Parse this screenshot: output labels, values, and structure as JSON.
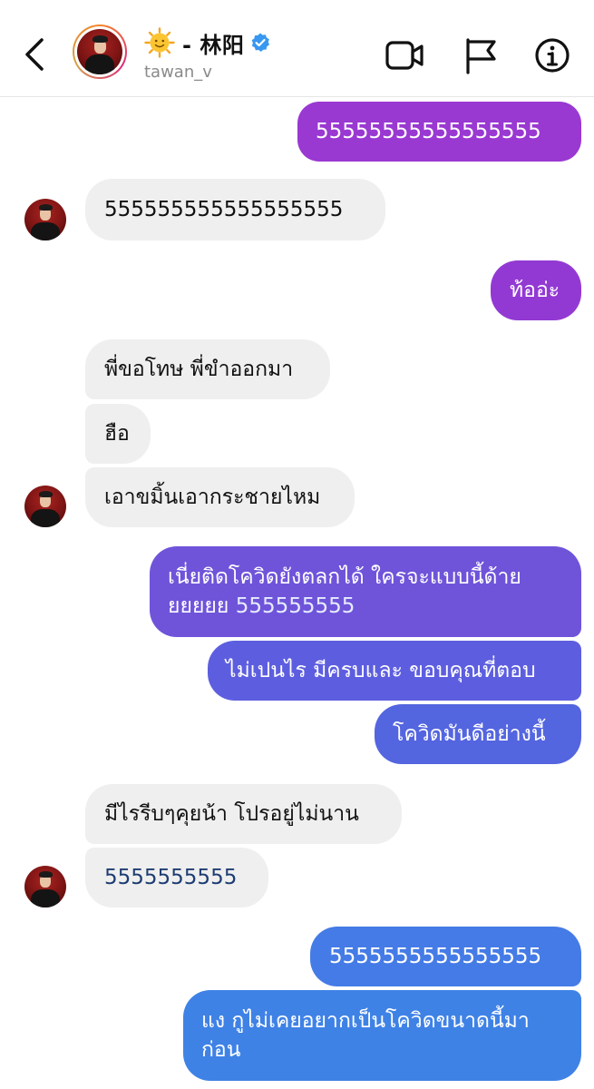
{
  "header": {
    "title": "- 林阳",
    "username": "tawan_v",
    "icons": [
      "back-icon",
      "sun-emoji-icon",
      "verified-badge-icon",
      "video-call-icon",
      "report-flag-icon",
      "info-icon"
    ]
  },
  "colors": {
    "incoming_bubble": "#efefef",
    "outgoing_gradient_top": "#9b38d2",
    "outgoing_gradient_mid": "#6a53d9",
    "outgoing_gradient_bottom": "#3f82e6",
    "verified_blue": "#3897f0"
  },
  "messages": [
    {
      "side": "out",
      "text": "55555555555555555"
    },
    {
      "side": "in",
      "text": "555555555555555555"
    },
    {
      "side": "out",
      "text": "ท้ออ่ะ"
    },
    {
      "side": "in",
      "text": "พี่ขอโทษ พี่ขำออกมา"
    },
    {
      "side": "in",
      "text": "ฮือ"
    },
    {
      "side": "in",
      "text": "เอาขมิ้นเอากระชายไหม"
    },
    {
      "side": "out",
      "line1": "เนี่ยติดโควิดยังตลกได้ ใครจะแบบนี้ด้าย",
      "line2_text": "ยยยยย ",
      "line2_num": "555555555"
    },
    {
      "side": "out",
      "text": "ไม่เปนไร มีครบและ ขอบคุณที่ตอบ"
    },
    {
      "side": "out",
      "text": "โควิดมันดีอย่างนี้"
    },
    {
      "side": "in",
      "text": "มีไรรีบๆคุยน้า โปรอยู่ไม่นาน"
    },
    {
      "side": "in",
      "text": "5555555555"
    },
    {
      "side": "out",
      "text": "5555555555555555"
    },
    {
      "side": "out",
      "line1": "แง กูไม่เคยอยากเป็นโควิดขนาดนี้มา",
      "line2": "ก่อน"
    }
  ]
}
